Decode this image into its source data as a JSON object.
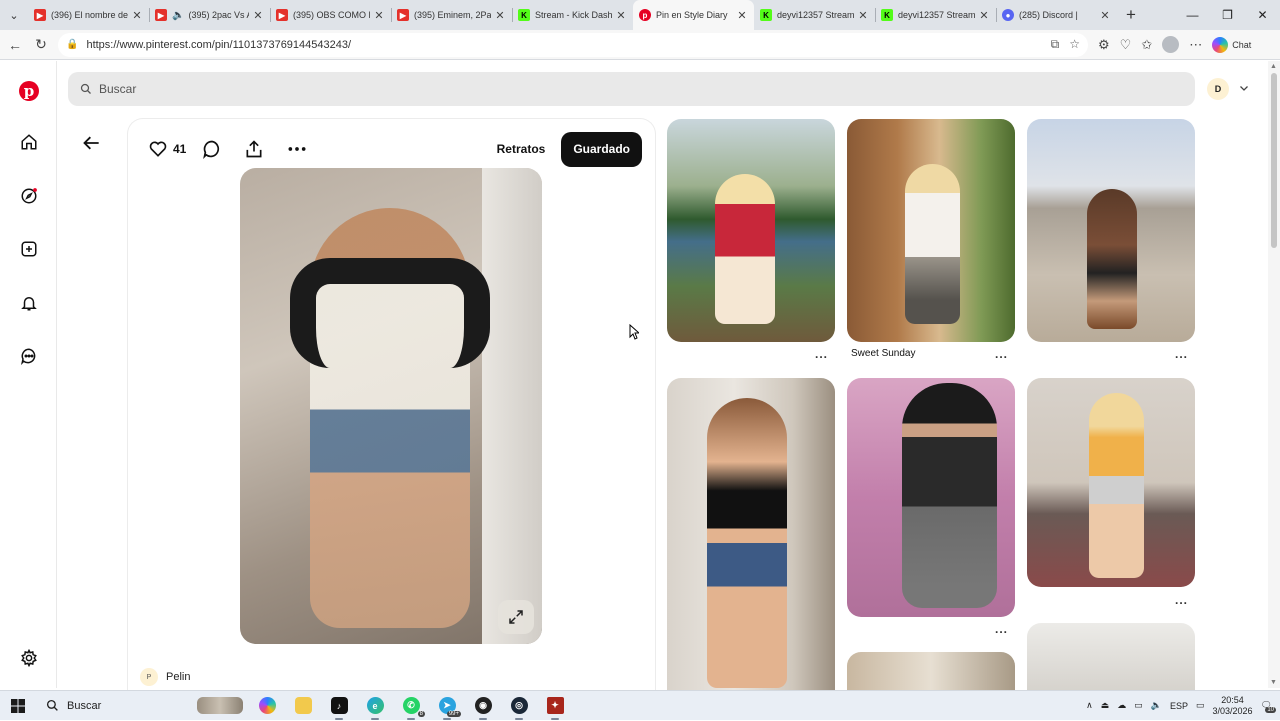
{
  "browser": {
    "tabs": [
      {
        "title": "(396) El nombre de",
        "favicon": "youtube-icon",
        "color": "#e4312b"
      },
      {
        "title": "(395) 2pac Vs A",
        "favicon": "youtube-icon",
        "color": "#e4312b"
      },
      {
        "title": "(395) OBS COMO E",
        "favicon": "youtube-icon",
        "color": "#e4312b"
      },
      {
        "title": "(395) Eminem, 2Pac",
        "favicon": "youtube-icon",
        "color": "#e4312b"
      },
      {
        "title": "Stream - Kick Dashb",
        "favicon": "kick-icon",
        "color": "#53fc18"
      },
      {
        "title": "Pin en Style Diary",
        "favicon": "pinterest-icon",
        "color": "#e60023",
        "active": true
      },
      {
        "title": "deyvi12357 Stream",
        "favicon": "kick-icon",
        "color": "#53fc18"
      },
      {
        "title": "deyvi12357 Stream",
        "favicon": "kick-icon",
        "color": "#53fc18"
      },
      {
        "title": "(285) Discord |",
        "favicon": "discord-icon",
        "color": "#5865f2"
      }
    ],
    "url": "https://www.pinterest.com/pin/1101373769144543243/",
    "copilot_label": "Chat"
  },
  "pinterest": {
    "search_placeholder": "Buscar",
    "account_initial": "D",
    "pin": {
      "likes": "41",
      "board_label": "Retratos",
      "saved_label": "Guardado",
      "author_initial": "P",
      "author_name": "Pelin"
    },
    "related": [
      {
        "title": "",
        "more": "..."
      },
      {
        "title": "Sweet Sunday",
        "more": "..."
      },
      {
        "title": "",
        "more": "..."
      },
      {
        "title": "",
        "more": ""
      },
      {
        "title": "",
        "more": "..."
      },
      {
        "title": "",
        "more": "..."
      },
      {
        "title": "",
        "more": ""
      },
      {
        "title": "",
        "more": ""
      }
    ]
  },
  "taskbar": {
    "search_label": "Buscar",
    "whatsapp_badge": "8",
    "telegram_badge": "99+",
    "language": "ESP",
    "time": "20:54",
    "date": "3/03/2026",
    "notifications": "10"
  },
  "colors": {
    "pinterest_red": "#e60023",
    "saved_button": "#111111",
    "search_bg": "#e9e9e9"
  }
}
